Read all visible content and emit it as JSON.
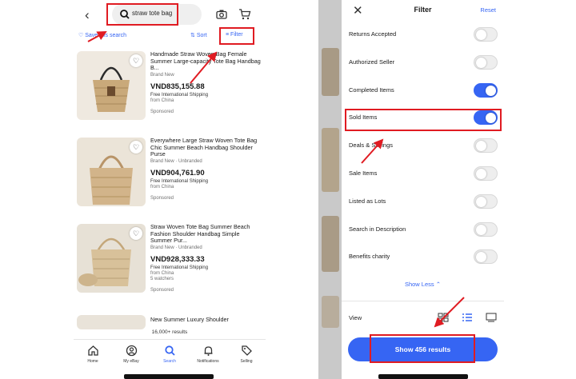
{
  "left": {
    "search": {
      "query": "straw tote bag"
    },
    "actions": {
      "save_search": "Save this search",
      "sort": "Sort",
      "filter": "Filter"
    },
    "listings": [
      {
        "title": "Handmade Straw Woven Bag Female Summer Large-capacity Tote Bag Handbag B...",
        "condition": "Brand New",
        "price": "VND835,155.88",
        "shipping": "Free International Shipping",
        "origin": "from China",
        "extra": "",
        "sponsored": "Sponsored"
      },
      {
        "title": "Everywhere Large Straw Woven Tote Bag Chic Summer Beach Handbag Shoulder Purse",
        "condition": "Brand New · Unbranded",
        "price": "VND904,761.90",
        "shipping": "Free International Shipping",
        "origin": "from China",
        "extra": "",
        "sponsored": "Sponsored"
      },
      {
        "title": "Straw Woven Tote Bag Summer Beach Fashion Shoulder Handbag Simple Summer Pur...",
        "condition": "Brand New · Unbranded",
        "price": "VND928,333.33",
        "shipping": "Free International Shipping",
        "origin": "from China",
        "extra": "5 watchers",
        "sponsored": "Sponsored"
      },
      {
        "title": "New Summer Luxury Shoulder",
        "condition": "",
        "price": "",
        "shipping": "",
        "origin": "",
        "extra": "",
        "sponsored": ""
      }
    ],
    "results_count": "16,000+ results",
    "tabs": [
      "Home",
      "My eBay",
      "Search",
      "Notifications",
      "Selling"
    ]
  },
  "right": {
    "header": {
      "title": "Filter",
      "reset": "Reset"
    },
    "filters": [
      {
        "label": "Returns Accepted",
        "on": false
      },
      {
        "label": "Authorized Seller",
        "on": false
      },
      {
        "label": "Completed Items",
        "on": true
      },
      {
        "label": "Sold Items",
        "on": true
      },
      {
        "label": "Deals & Savings",
        "on": false
      },
      {
        "label": "Sale Items",
        "on": false
      },
      {
        "label": "Listed as Lots",
        "on": false
      },
      {
        "label": "Search in Description",
        "on": false
      },
      {
        "label": "Benefits charity",
        "on": false
      }
    ],
    "show_less": "Show Less",
    "view_label": "View",
    "show_button": "Show 456 results"
  },
  "colors": {
    "accent": "#3665f3",
    "highlight": "#e01b22"
  }
}
